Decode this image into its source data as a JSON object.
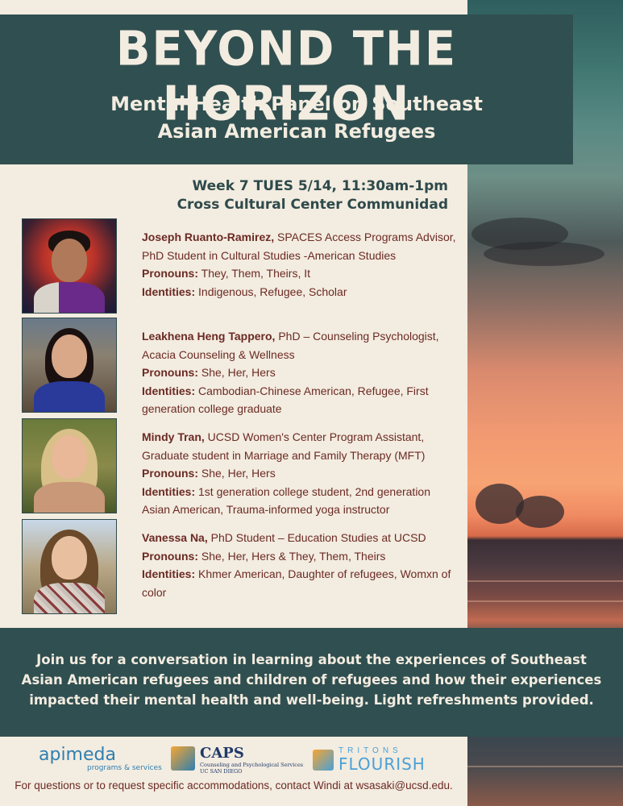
{
  "header": {
    "title": "BEYOND THE HORIZON",
    "subtitle_line1": "Mental Health Panel on Southeast",
    "subtitle_line2": "Asian American Refugees"
  },
  "event": {
    "when": "Week 7 TUES 5/14, 11:30am-1pm",
    "where": "Cross Cultural Center Communidad"
  },
  "labels": {
    "pronouns": "Pronouns:",
    "identities": "Identities:"
  },
  "panelists": [
    {
      "name": "Joseph Ruanto-Ramirez,",
      "role": " SPACES Access Programs Advisor, PhD Student in Cultural Studies -American Studies",
      "pronouns": " They, Them, Theirs, It",
      "identities": " Indigenous, Refugee, Scholar"
    },
    {
      "name": "Leakhena Heng Tappero,",
      "role": " PhD – Counseling Psychologist, Acacia Counseling & Wellness",
      "pronouns": " She, Her, Hers",
      "identities": " Cambodian-Chinese American, Refugee, First generation college graduate"
    },
    {
      "name": "Mindy Tran,",
      "role": " UCSD Women's Center Program Assistant, Graduate student in Marriage and Family Therapy (MFT)",
      "pronouns": " She, Her, Hers",
      "identities": " 1st generation college student, 2nd generation Asian American, Trauma-informed yoga instructor"
    },
    {
      "name": "Vanessa Na,",
      "role": " PhD Student – Education Studies at UCSD",
      "pronouns": " She, Her, Hers & They, Them, Theirs",
      "identities": " Khmer American, Daughter of refugees, Womxn of color"
    }
  ],
  "footer": {
    "description": "Join us for a conversation in learning about the experiences of Southeast Asian American refugees and children of refugees and how their experiences impacted their mental health and well-being. Light refreshments provided.",
    "contact": "For questions or to request specific accommodations, contact Windi at wsasaki@ucsd.edu."
  },
  "logos": {
    "apimeda": "apimeda",
    "apimeda_tagline": "programs & services",
    "caps": "CAPS",
    "caps_tagline_1": "Counseling and Psychological Services",
    "caps_tagline_2": "UC SAN DIEGO",
    "tritons": "TRITONS",
    "flourish": "FLOURISH"
  },
  "colors": {
    "header_bg": "#304f50",
    "cream": "#f3ece0",
    "text_maroon": "#6b2a24",
    "accent_teal": "#2e4a4b"
  }
}
